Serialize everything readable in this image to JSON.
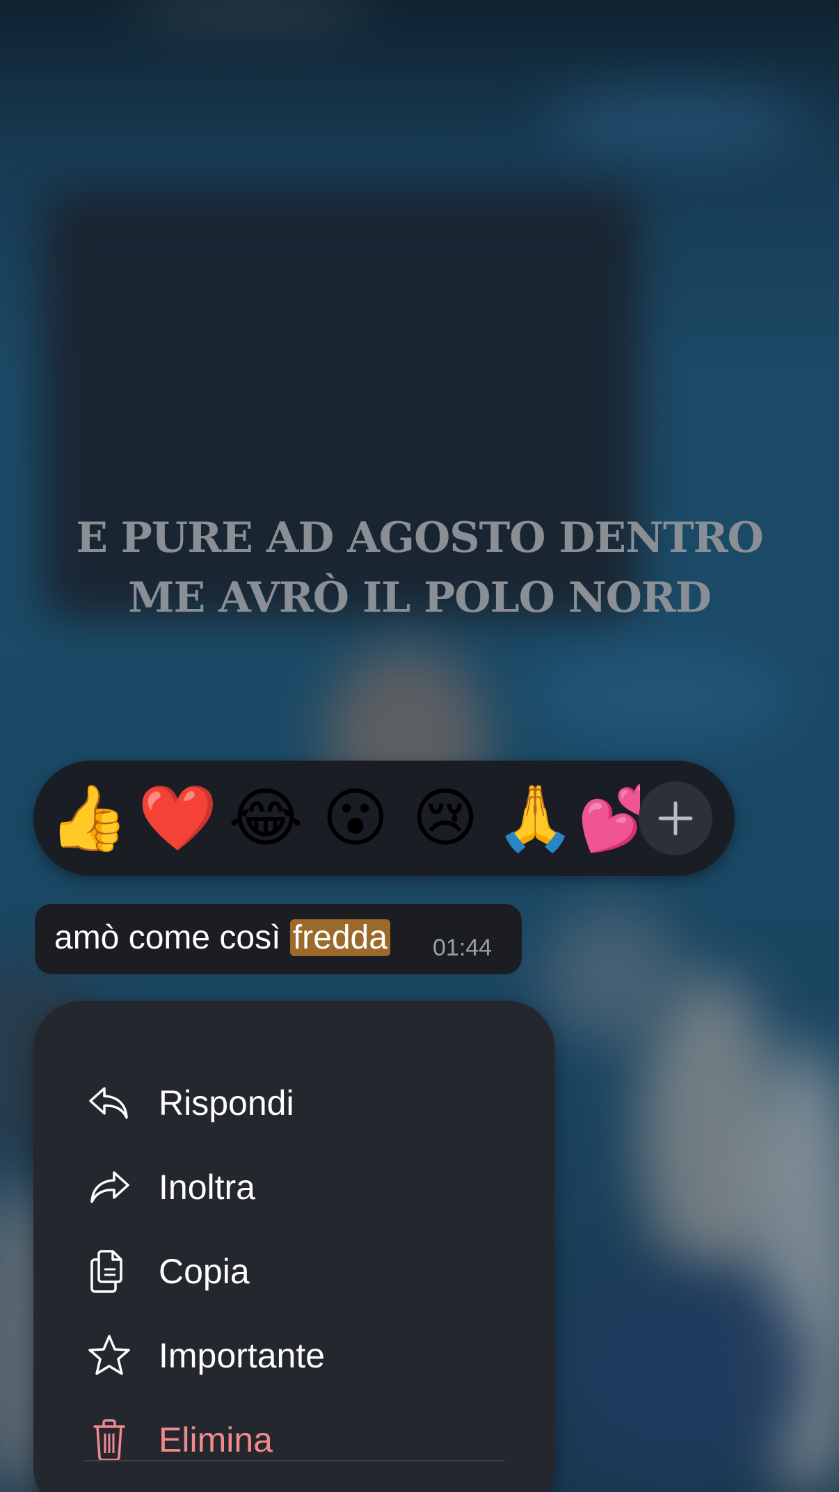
{
  "background": {
    "quote_lines": [
      "E PURE AD AGOSTO DENTRO",
      "ME AVRÒ IL POLO NORD"
    ]
  },
  "reactions": {
    "emojis": [
      {
        "char": "👍",
        "name": "thumbs-up"
      },
      {
        "char": "❤️",
        "name": "red-heart"
      },
      {
        "char": "😂",
        "name": "tears-of-joy"
      },
      {
        "char": "😮",
        "name": "surprised-face"
      },
      {
        "char": "😢",
        "name": "crying-face"
      },
      {
        "char": "🙏",
        "name": "folded-hands"
      },
      {
        "char": "💕",
        "name": "two-hearts"
      }
    ],
    "more_icon": "plus-icon"
  },
  "message": {
    "text_before": "amò come così ",
    "text_highlight": "fredda",
    "time": "01:44",
    "highlight_color": "#9b6a2a"
  },
  "menu": {
    "items": [
      {
        "label": "Rispondi",
        "icon": "reply-icon"
      },
      {
        "label": "Inoltra",
        "icon": "forward-icon"
      },
      {
        "label": "Copia",
        "icon": "copy-icon"
      },
      {
        "label": "Importante",
        "icon": "star-icon"
      },
      {
        "label": "Elimina",
        "icon": "trash-icon",
        "color": "#f08a8d"
      }
    ]
  }
}
